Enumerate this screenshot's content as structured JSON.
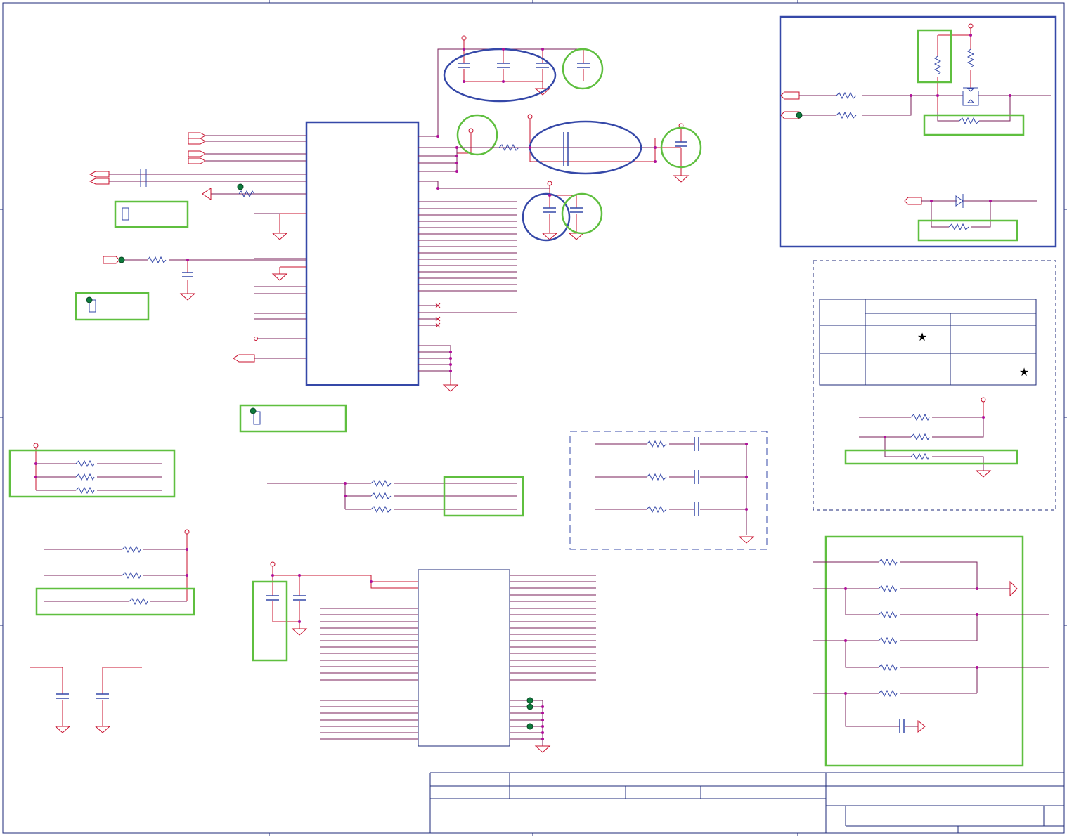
{
  "page": {
    "title": ""
  },
  "legend_table": {
    "marks": [
      "★",
      "★"
    ]
  },
  "colors": {
    "wire": "#c8102e",
    "net": "#7a1f5a",
    "component": "#3548a8",
    "highlight_green": "#5fbf3f",
    "highlight_blue": "#3548a8",
    "test_point": "#0e7a3c",
    "frame": "#1e2a78"
  }
}
